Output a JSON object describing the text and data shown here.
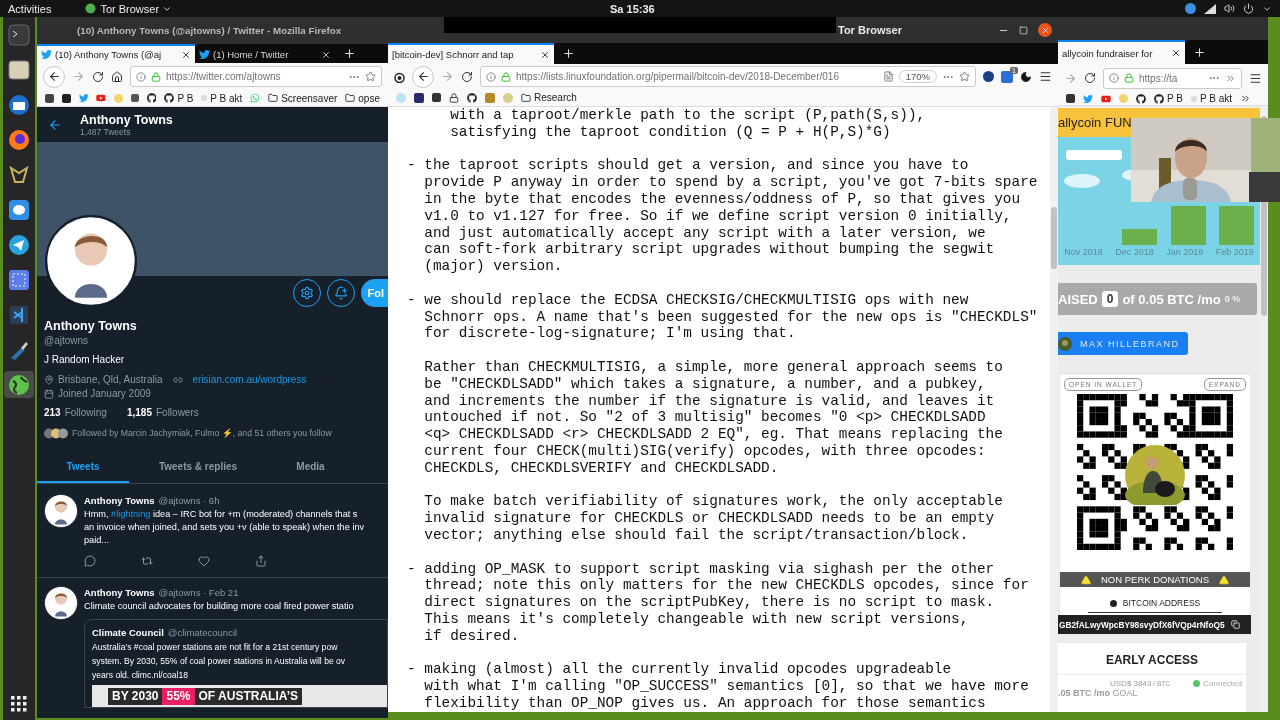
{
  "top_bar": {
    "activities": "Activities",
    "app_menu": "Tor Browser",
    "clock": "Sa 15:36"
  },
  "dock_items": [
    {
      "selected": false
    },
    {
      "selected": false
    },
    {
      "selected": false
    },
    {
      "selected": false
    },
    {
      "selected": false
    },
    {
      "selected": false
    },
    {
      "selected": false
    },
    {
      "selected": false
    },
    {
      "selected": false
    },
    {
      "selected": false
    },
    {
      "selected": true
    }
  ],
  "twitter_window": {
    "title": "(10) Anthony Towns (@ajtowns) / Twitter - Mozilla Firefox",
    "tabs": [
      {
        "label": "(10) Anthony Towns (@aj",
        "selected": true
      },
      {
        "label": "(1) Home / Twitter",
        "selected": false
      }
    ],
    "url": "https://twitter.com/ajtowns",
    "bookmarks": [
      "P B",
      "P B akt",
      "Screensaver",
      "opse"
    ],
    "header": {
      "name": "Anthony Towns",
      "count": "1,487 Tweets"
    },
    "follow_button": "Fol",
    "profile": {
      "name": "Anthony Towns",
      "handle": "@ajtowns",
      "bio": "J Random Hacker",
      "location": "Brisbane, Qld, Australia",
      "website": "erisian.com.au/wordpress",
      "joined": "Joined January 2009",
      "following_count": "213",
      "following_label": "Following",
      "followers_count": "1,185",
      "followers_label": "Followers",
      "followed_by": "Followed by Marcin Jachymiak, Fulmo ⚡, and 51 others you follow"
    },
    "profile_tabs": [
      {
        "label": "Tweets",
        "selected": true
      },
      {
        "label": "Tweets & replies",
        "selected": false
      },
      {
        "label": "Media",
        "selected": false
      }
    ],
    "tweets": [
      {
        "author": "Anthony Towns",
        "meta": "@ajtowns · 6h",
        "text": [
          {
            "kind": "plain",
            "text": "Hmm, "
          },
          {
            "kind": "hashtag",
            "text": "#lightning"
          },
          {
            "kind": "plain",
            "text": " idea – IRC bot for +m (moderated) channels that s\nan invoice when joined, and sets you +v (able to speak) when the inv\npaid..."
          }
        ]
      },
      {
        "author": "Anthony Towns",
        "meta": "@ajtowns · Feb 21",
        "text": [
          {
            "kind": "plain",
            "text": "Climate council advocates for building more coal fired power statio"
          }
        ],
        "quote": {
          "author": "Climate Council",
          "handle": "@climatecouncil",
          "text": "Australia’s #coal power stations are not fit for a 21st century pow\nsystem. By 2030, 55% of coal power stations in Australia will be ov\nyears old. climc.nl/coal18",
          "banner": [
            {
              "text": "BY 2030",
              "highlight": false
            },
            {
              "text": "55%",
              "highlight": true
            },
            {
              "text": "OF AUSTRALIA’S",
              "highlight": false
            }
          ]
        }
      }
    ]
  },
  "mail_window": {
    "title": "Tor Browser",
    "tabs": [
      {
        "label": "[bitcoin-dev] Schnorr and tap",
        "selected": true
      }
    ],
    "url": "https://lists.linuxfoundation.org/pipermail/bitcoin-dev/2018-December/016",
    "zoom": "170%",
    "extension_badge": "1",
    "bookmarks": [
      "Research"
    ],
    "body": [
      "     with a taproot/merkle path to the script (P,path(S,s)),\n     satisfying the taproot condition (Q = P + H(P,S)*G)",
      "- the taproot scripts should get a version, and since you have to\n  provide P anyway in order to spend by a script, you've got 7-bits spare\n  in the byte that encodes the evenness/oddness of P, so that gives you\n  v1.0 to v1.127 for free. So if we define script version 0 initially,\n  and just automatically accept any script with a later version, we\n  can soft-fork arbitrary script upgrades without bumping the segwit\n  (major) version.",
      "- we should replace the ECDSA CHECKSIG/CHECKMULTISIG ops with new\n  Schnorr ops. A name that's been suggested for the new ops is \"CHECKDLS\"\n  for discrete-log-signature; I'm using that.",
      "  Rather than CHECKMULTISIG, a simple, more general approach seems to\n  be \"CHECKDLSADD\" which takes a signature, a number, and a pubkey,\n  and increments the number if the signature is valid, and leaves it\n  untouched if not. So \"2 of 3 multisig\" becomes \"0 <p> CHECKDLSADD\n  <q> CHECKDLSADD <r> CHECKDLSADD 2 EQ\", eg. That means replacing the\n  current four CHECK(multi)SIG(verify) opcodes, with three opcodes:\n  CHECKDLS, CHECKDLSVERIFY and CHECKDLSADD.",
      "  To make batch verifiability of signatures work, the only acceptable\n  invalid signature for CHECKDLS or CHECKDLSADD needs to be an empty\n  vector; anything else should fail the script/transaction/block.",
      "- adding OP_MASK to support script masking via sighash per the other\n  thread; note this only matters for the new CHECKDLS opcodes, since for\n  direct signatures on the scriptPubKey, there is no script to mask.\n  This means it's completely changeable with new script versions,\n  if desired.",
      "- making (almost) all the currently invalid opcodes upgradeable\n  with what I'm calling \"OP_SUCCESS\" semantics [0], so that we have more\n  flexibility than OP_NOP gives us. An approach for those semantics"
    ]
  },
  "fundraiser_window": {
    "tabs": [
      {
        "label": "allycoin fundraiser for",
        "selected": true
      }
    ],
    "url": "https://ta",
    "bookmarks": [
      "P B",
      "P B akt"
    ],
    "header": "allycoin FUN",
    "months": [
      "Nov 2018",
      "Dec 2018",
      "Jan 2019",
      "Feb 2019"
    ],
    "raised": {
      "label": "AISED",
      "amount": "0",
      "goal": "of 0.05 BTC /mo",
      "percent": "0 %"
    },
    "creator": "MAX HILLEBRAND",
    "wallet_button": "OPEN IN WALLET",
    "expand_button": "EXPAND",
    "donation_banner": "NON PERK DONATIONS",
    "address_label": "BITCOIN ADDRESS",
    "address": "GB2fALwyWpcBY98svyDfX6fVQp4rNfoQ5",
    "early_access": "EARLY ACCESS",
    "price": "USD$ 3843",
    "price_unit": "/ BTC",
    "status": "Connected",
    "goal": "**.05 BTC /mo** GOAL"
  }
}
